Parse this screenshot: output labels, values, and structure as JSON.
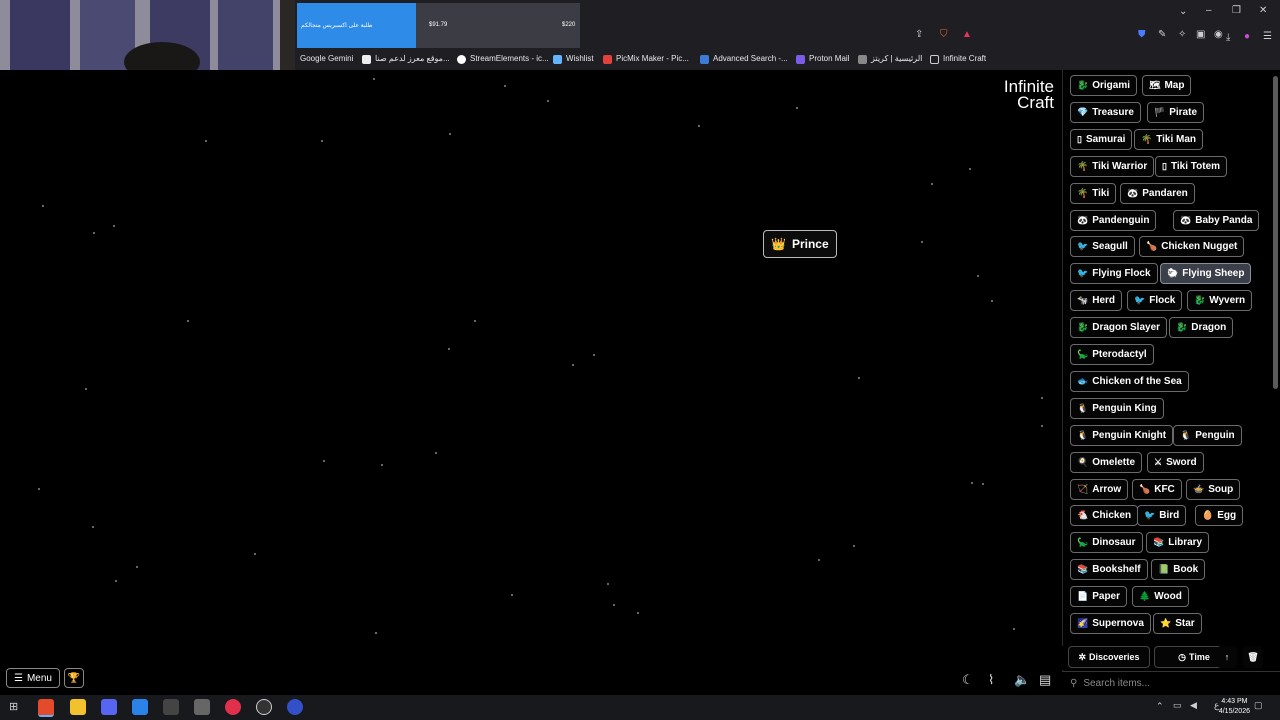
{
  "banner": {
    "text": "طلبة على اكسبريس متجالكم",
    "price1": "$91.79",
    "price2": "$220"
  },
  "bookmarks": [
    {
      "label": "Google Gemini",
      "color": "#4b8bf5"
    },
    {
      "label": "موقع معرز لدعم صنا...",
      "color": "#eeeeee"
    },
    {
      "label": "StreamElements - ic...",
      "color": "#ffffff"
    },
    {
      "label": "Wishlist",
      "color": "#66b3ff"
    },
    {
      "label": "PicMix Maker - Pic...",
      "color": "#e3413c"
    },
    {
      "label": "Advanced Search -...",
      "color": "#3c7bd6"
    },
    {
      "label": "Proton Mail",
      "color": "#7b5ce6"
    },
    {
      "label": "الرئيسية | كريتز",
      "color": "#888888"
    },
    {
      "label": "Infinite Craft",
      "color": "#cccccc"
    }
  ],
  "logo": {
    "line1": "Infinite",
    "line2": "Craft"
  },
  "canvas_item": {
    "emoji": "👑",
    "label": "Prince"
  },
  "sidebar_items": [
    {
      "emoji": "🐉",
      "label": "Origami"
    },
    {
      "emoji": "🗺",
      "label": "Map"
    },
    {
      "emoji": "💎",
      "label": "Treasure"
    },
    {
      "emoji": "🏴",
      "label": "Pirate"
    },
    {
      "emoji": "▯",
      "label": "Samurai"
    },
    {
      "emoji": "🌴",
      "label": "Tiki Man"
    },
    {
      "emoji": "🌴",
      "label": "Tiki Warrior"
    },
    {
      "emoji": "▯",
      "label": "Tiki Totem"
    },
    {
      "emoji": "🌴",
      "label": "Tiki"
    },
    {
      "emoji": "🐼",
      "label": "Pandaren"
    },
    {
      "emoji": "🐼",
      "label": "Pandenguin"
    },
    {
      "emoji": "🐼",
      "label": "Baby Panda"
    },
    {
      "emoji": "🐦",
      "label": "Seagull"
    },
    {
      "emoji": "🍗",
      "label": "Chicken Nugget"
    },
    {
      "emoji": "🐦",
      "label": "Flying Flock"
    },
    {
      "emoji": "🐑",
      "label": "Flying Sheep"
    },
    {
      "emoji": "🐄",
      "label": "Herd"
    },
    {
      "emoji": "🐦",
      "label": "Flock"
    },
    {
      "emoji": "🐉",
      "label": "Wyvern"
    },
    {
      "emoji": "🐉",
      "label": "Dragon Slayer"
    },
    {
      "emoji": "🐉",
      "label": "Dragon"
    },
    {
      "emoji": "🦕",
      "label": "Pterodactyl"
    },
    {
      "emoji": "🐟",
      "label": "Chicken of the Sea"
    },
    {
      "emoji": "🐧",
      "label": "Penguin King"
    },
    {
      "emoji": "🐧",
      "label": "Penguin Knight"
    },
    {
      "emoji": "🐧",
      "label": "Penguin"
    },
    {
      "emoji": "🍳",
      "label": "Omelette"
    },
    {
      "emoji": "⚔",
      "label": "Sword"
    },
    {
      "emoji": "🏹",
      "label": "Arrow"
    },
    {
      "emoji": "🍗",
      "label": "KFC"
    },
    {
      "emoji": "🍲",
      "label": "Soup"
    },
    {
      "emoji": "🐔",
      "label": "Chicken"
    },
    {
      "emoji": "🐦",
      "label": "Bird"
    },
    {
      "emoji": "🥚",
      "label": "Egg"
    },
    {
      "emoji": "🦕",
      "label": "Dinosaur"
    },
    {
      "emoji": "📚",
      "label": "Library"
    },
    {
      "emoji": "📚",
      "label": "Bookshelf"
    },
    {
      "emoji": "📗",
      "label": "Book"
    },
    {
      "emoji": "📄",
      "label": "Paper"
    },
    {
      "emoji": "🌲",
      "label": "Wood"
    },
    {
      "emoji": "🌠",
      "label": "Supernova"
    },
    {
      "emoji": "⭐",
      "label": "Star"
    }
  ],
  "tabs": {
    "discoveries": "Discoveries",
    "time": "Time",
    "sort": "↑",
    "trash": "🗑"
  },
  "search": {
    "placeholder": "Search items..."
  },
  "menu": {
    "label": "Menu"
  },
  "clock": {
    "time": "4:43 PM",
    "date": "4/15/2026",
    "lang": "ع"
  }
}
